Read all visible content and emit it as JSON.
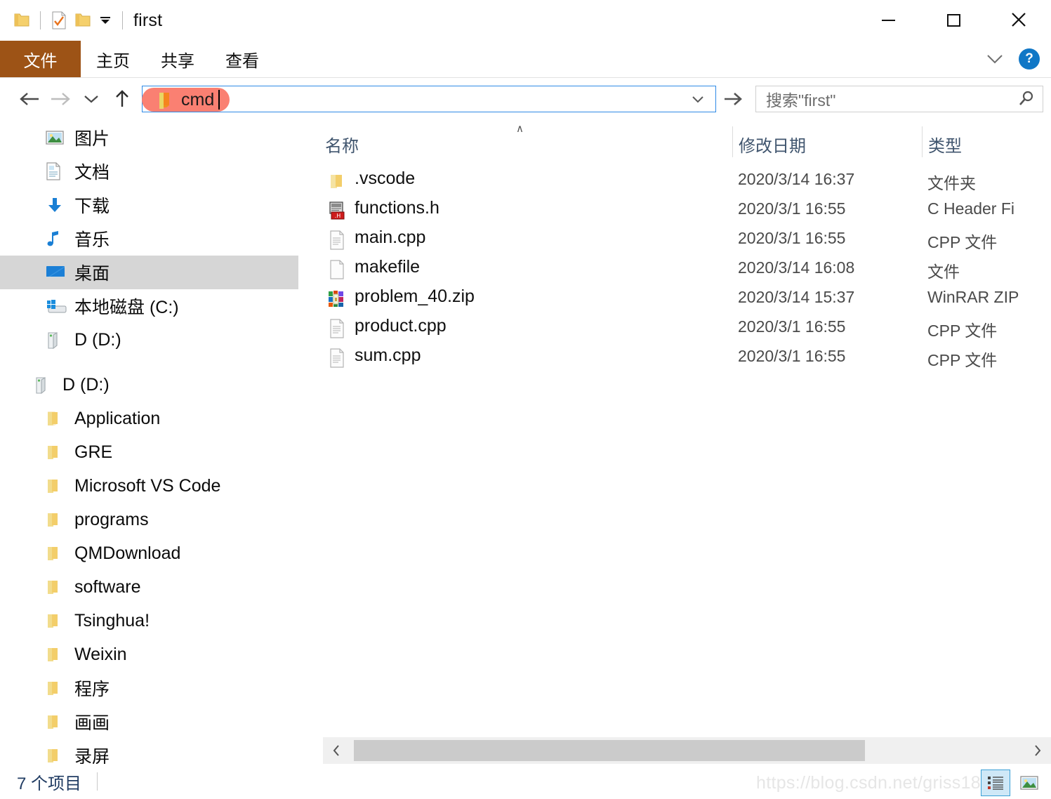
{
  "window": {
    "title": "first",
    "quick_access": [
      {
        "name": "folder-icon",
        "label": "folder"
      },
      {
        "name": "properties-icon",
        "label": "properties"
      },
      {
        "name": "new-folder-icon",
        "label": "new folder"
      },
      {
        "name": "customize-quick-access-caret",
        "label": "customize"
      }
    ],
    "controls": {
      "minimize": "minimize",
      "maximize": "maximize",
      "close": "close"
    }
  },
  "ribbon": {
    "tabs": [
      {
        "label": "文件",
        "active": true
      },
      {
        "label": "主页",
        "active": false
      },
      {
        "label": "共享",
        "active": false
      },
      {
        "label": "查看",
        "active": false
      }
    ],
    "collapse_icon": "chevron-down-icon",
    "help_label": "?",
    "file_tab_color": "#9D5316"
  },
  "nav": {
    "back": "←",
    "forward": "→",
    "recent": "⌄",
    "up": "↑",
    "address": {
      "value": "cmd",
      "pill_color": "#FA8072",
      "border_color": "#2E8AE6",
      "dropdown_icon": "chevron-down-icon",
      "go_icon": "arrow-right-icon"
    },
    "search": {
      "placeholder": "搜索\"first\"",
      "icon": "search-icon"
    }
  },
  "sidebar": {
    "items": [
      {
        "label": "图片",
        "icon": "pictures-icon",
        "indent": 1,
        "selected": false
      },
      {
        "label": "文档",
        "icon": "documents-icon",
        "indent": 1,
        "selected": false
      },
      {
        "label": "下载",
        "icon": "downloads-icon",
        "indent": 1,
        "selected": false
      },
      {
        "label": "音乐",
        "icon": "music-icon",
        "indent": 1,
        "selected": false
      },
      {
        "label": "桌面",
        "icon": "desktop-icon",
        "indent": 1,
        "selected": true
      },
      {
        "label": "本地磁盘 (C:)",
        "icon": "windows-drive-icon",
        "indent": 1,
        "selected": false
      },
      {
        "label": "D (D:)",
        "icon": "drive-icon",
        "indent": 1,
        "selected": false
      },
      {
        "label": "D (D:)",
        "icon": "drive-icon",
        "indent": 0,
        "selected": false,
        "gap_before": true
      },
      {
        "label": "Application",
        "icon": "folder-icon",
        "indent": 1,
        "selected": false
      },
      {
        "label": "GRE",
        "icon": "folder-icon",
        "indent": 1,
        "selected": false
      },
      {
        "label": "Microsoft VS Code",
        "icon": "folder-icon",
        "indent": 1,
        "selected": false
      },
      {
        "label": "programs",
        "icon": "folder-icon",
        "indent": 1,
        "selected": false
      },
      {
        "label": "QMDownload",
        "icon": "folder-icon",
        "indent": 1,
        "selected": false
      },
      {
        "label": "software",
        "icon": "folder-icon",
        "indent": 1,
        "selected": false
      },
      {
        "label": "Tsinghua!",
        "icon": "folder-icon",
        "indent": 1,
        "selected": false
      },
      {
        "label": "Weixin",
        "icon": "folder-icon",
        "indent": 1,
        "selected": false
      },
      {
        "label": "程序",
        "icon": "folder-icon",
        "indent": 1,
        "selected": false
      },
      {
        "label": "画画",
        "icon": "folder-icon",
        "indent": 1,
        "selected": false
      },
      {
        "label": "录屏",
        "icon": "folder-icon",
        "indent": 1,
        "selected": false
      }
    ]
  },
  "file_list": {
    "columns": [
      {
        "label": "名称",
        "sorted": true,
        "sort_dir": "asc"
      },
      {
        "label": "修改日期",
        "sorted": false
      },
      {
        "label": "类型",
        "sorted": false
      }
    ],
    "rows": [
      {
        "name": ".vscode",
        "date": "2020/3/14 16:37",
        "type": "文件夹",
        "icon": "folder-icon"
      },
      {
        "name": "functions.h",
        "date": "2020/3/1 16:55",
        "type": "C Header Fi",
        "icon": "h-file-icon"
      },
      {
        "name": "main.cpp",
        "date": "2020/3/1 16:55",
        "type": "CPP 文件",
        "icon": "cpp-file-icon"
      },
      {
        "name": "makefile",
        "date": "2020/3/14 16:08",
        "type": "文件",
        "icon": "blank-file-icon"
      },
      {
        "name": "problem_40.zip",
        "date": "2020/3/14 15:37",
        "type": "WinRAR ZIP",
        "icon": "winrar-zip-icon"
      },
      {
        "name": "product.cpp",
        "date": "2020/3/1 16:55",
        "type": "CPP 文件",
        "icon": "cpp-file-icon"
      },
      {
        "name": "sum.cpp",
        "date": "2020/3/1 16:55",
        "type": "CPP 文件",
        "icon": "cpp-file-icon"
      }
    ]
  },
  "status": {
    "item_count": "7 个项目",
    "view_buttons": [
      {
        "name": "details-view-button",
        "active": true
      },
      {
        "name": "large-icons-view-button",
        "active": false
      }
    ]
  },
  "watermark": "https://blog.csdn.net/griss18"
}
